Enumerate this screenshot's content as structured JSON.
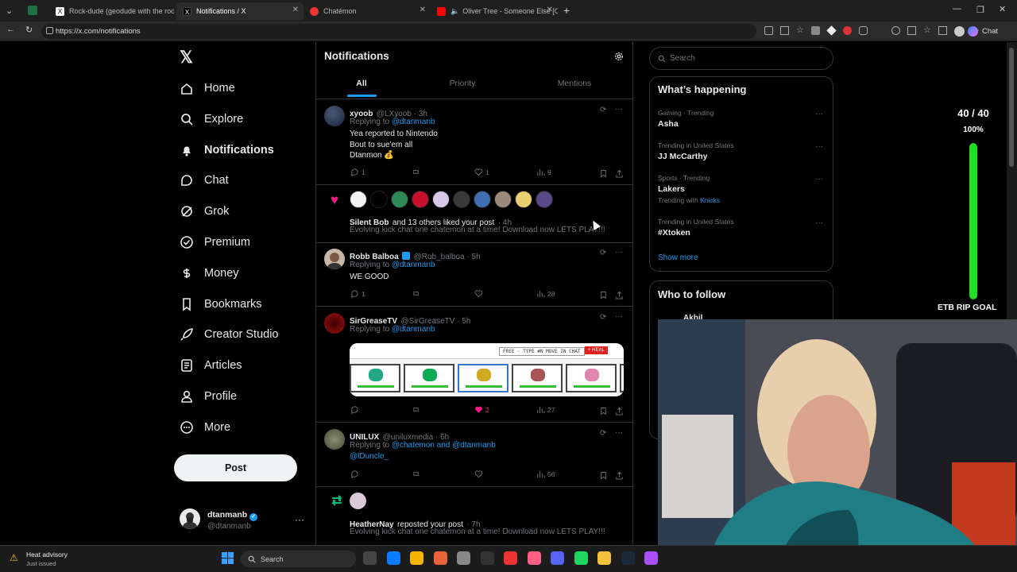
{
  "browser": {
    "tabs": [
      {
        "title": "Rock-dude (geodude with the roc",
        "active": false
      },
      {
        "title": "Notifications / X",
        "active": true
      },
      {
        "title": "Chatémon",
        "active": false
      },
      {
        "title": "Oliver Tree - Someone Else [O",
        "active": false
      }
    ],
    "url": "https://x.com/notifications",
    "chat_label": "Chat"
  },
  "nav": {
    "items": [
      {
        "label": "Home",
        "icon": "home-icon"
      },
      {
        "label": "Explore",
        "icon": "search-icon"
      },
      {
        "label": "Notifications",
        "icon": "bell-icon"
      },
      {
        "label": "Chat",
        "icon": "chat-icon"
      },
      {
        "label": "Grok",
        "icon": "grok-icon"
      },
      {
        "label": "Premium",
        "icon": "premium-icon"
      },
      {
        "label": "Money",
        "icon": "money-icon"
      },
      {
        "label": "Bookmarks",
        "icon": "bookmark-icon"
      },
      {
        "label": "Creator Studio",
        "icon": "rocket-icon"
      },
      {
        "label": "Articles",
        "icon": "article-icon"
      },
      {
        "label": "Profile",
        "icon": "person-icon"
      },
      {
        "label": "More",
        "icon": "more-circle-icon"
      }
    ],
    "post_label": "Post",
    "account": {
      "name": "dtanmanb",
      "handle": "@dtanmanb"
    }
  },
  "main": {
    "title": "Notifications",
    "tabs": [
      "All",
      "Priority",
      "Mentions"
    ],
    "notifications": [
      {
        "name": "xyoob",
        "handle": "@LXyoob · 3h",
        "replying_to": "Replying to",
        "replying_handle": "@dtanmanb",
        "lines": [
          "Yea reported to Nintendo",
          "Bout to sue'em all",
          "Dtanmon 💰"
        ],
        "replies": "1",
        "likes": "1",
        "views": "9"
      },
      {
        "summary_name": "Silent Bob",
        "summary_rest": "and 13 others liked your post",
        "summary_time": "· 4h",
        "summary_text": "Evolving kick chat one chatemon at a time! Download now LETS PLAY!!!"
      },
      {
        "name": "Robb Balboa",
        "handle": "@Rob_balboa · 5h",
        "replying_to": "Replying to",
        "replying_handle": "@dtanmanb",
        "lines": [
          "WE GOOD"
        ],
        "replies": "1",
        "views": "28"
      },
      {
        "name": "SirGreaseTV",
        "handle": "@SirGreaseTV · 5h",
        "replying_to": "Replying to",
        "replying_handle": "@dtanmanb",
        "image_header": "FREE · TYPE #N MOVE IN CHAT",
        "image_button": "+ HEAL ",
        "likes": "2",
        "views": "27"
      },
      {
        "name": "UNILUX",
        "handle": "@uniluxmedia · 6h",
        "replying_to": "Replying to",
        "replying_handle": "@chatemon and @dtanmanb",
        "replying_handle2": "@lDuncle_",
        "views": "56"
      },
      {
        "summary_name": "HeatherNay",
        "summary_rest": "reposted your post",
        "summary_time": "· 7h",
        "summary_text": "Evolving kick chat one chatemon at a time! Download now LETS PLAY!!!"
      }
    ]
  },
  "sidebar": {
    "search_placeholder": "Search",
    "happening_title": "What’s happening",
    "trends": [
      {
        "meta": "Gaming · Trending",
        "title": "Asha"
      },
      {
        "meta": "Trending in United States",
        "title": "JJ McCarthy"
      },
      {
        "meta": "Sports · Trending",
        "title": "Lakers",
        "extra_prefix": "Trending with",
        "extra_link": "Knicks"
      },
      {
        "meta": "Trending in United States",
        "title": "#Xtoken"
      }
    ],
    "show_more": "Show more",
    "who_to_follow": "Who to follow",
    "follow_name": "Akhil"
  },
  "overlay": {
    "goal_count": "40 / 40",
    "goal_percent": "100%",
    "goal_label": "ETB RIP GOAL",
    "goal_fraction": 1.0
  },
  "taskbar": {
    "weather_title": "Heat advisory",
    "weather_sub": "Just issued",
    "search_label": "Search"
  },
  "colors": {
    "accent": "#1d9bf0",
    "like": "#f91880",
    "repost": "#00ba7c",
    "goal": "#22dd22"
  }
}
